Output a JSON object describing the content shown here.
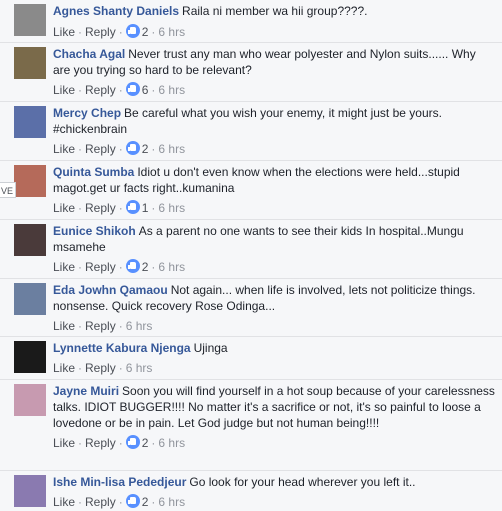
{
  "comments": [
    {
      "author": "Agnes Shanty Daniels",
      "text": "Raila ni member wa hii group????.",
      "like_label": "Like",
      "reply_label": "Reply",
      "reactions": "2",
      "time": "6 hrs",
      "avatar_color": "#8a8a8a"
    },
    {
      "author": "Chacha Agal",
      "text": "Never trust any man who wear polyester and Nylon suits...... Why are you trying so hard to be relevant?",
      "like_label": "Like",
      "reply_label": "Reply",
      "reactions": "6",
      "time": "6 hrs",
      "avatar_color": "#7a6a4a"
    },
    {
      "author": "Mercy Chep",
      "text": "Be careful what you wish your enemy, it might just be yours. #chickenbrain",
      "like_label": "Like",
      "reply_label": "Reply",
      "reactions": "2",
      "time": "6 hrs",
      "avatar_color": "#5b6fa8"
    },
    {
      "author": "Quinta Sumba",
      "text": "Idiot u don't even know when the elections were held...stupid magot.get ur facts right..kumanina",
      "like_label": "Like",
      "reply_label": "Reply",
      "reactions": "1",
      "time": "6 hrs",
      "avatar_color": "#b56a5a"
    },
    {
      "author": "Eunice Shikoh",
      "text": "As a parent no one wants to see their kids In hospital..Mungu msamehe",
      "like_label": "Like",
      "reply_label": "Reply",
      "reactions": "2",
      "time": "6 hrs",
      "avatar_color": "#4a3a3a"
    },
    {
      "author": "Eda Jowhn Qamaou",
      "text": "Not again... when life is involved, lets not politicize things. nonsense. Quick recovery Rose Odinga...",
      "like_label": "Like",
      "reply_label": "Reply",
      "reactions": "",
      "time": "6 hrs",
      "avatar_color": "#6b7fa0"
    },
    {
      "author": "Lynnette Kabura Njenga",
      "text": "Ujinga",
      "like_label": "Like",
      "reply_label": "Reply",
      "reactions": "",
      "time": "6 hrs",
      "avatar_color": "#1a1a1a"
    },
    {
      "author": "Jayne Muiri",
      "text": "Soon you will find yourself in a hot soup because of your carelessness talks. IDIOT BUGGER!!!! No matter it's a sacrifice or not, it's so painful to loose a lovedone or be in pain. Let God judge but not human being!!!!",
      "like_label": "Like",
      "reply_label": "Reply",
      "reactions": "2",
      "time": "6 hrs",
      "avatar_color": "#c79ab0"
    },
    {
      "author": "Ishe Min-lisa Pededjeur",
      "text": "Go look for your head wherever you left it..",
      "like_label": "Like",
      "reply_label": "Reply",
      "reactions": "2",
      "time": "6 hrs",
      "avatar_color": "#8a7ab0"
    }
  ],
  "side_tag": "VE"
}
